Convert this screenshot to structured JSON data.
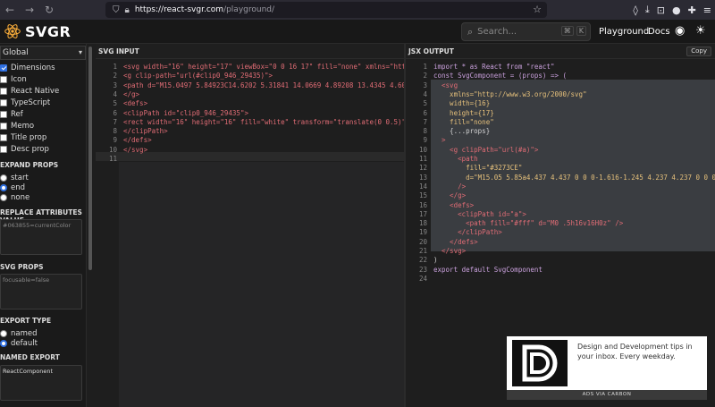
{
  "browser": {
    "url_host": "https://react-svgr.com",
    "url_path": "/playground/"
  },
  "header": {
    "logo_text": "SVGR",
    "search_placeholder": "Search...",
    "search_kbd_1": "⌘",
    "search_kbd_2": "K",
    "nav_playground": "Playground",
    "nav_docs": "Docs"
  },
  "sidebar": {
    "scope": "Global",
    "options": [
      {
        "label": "Dimensions",
        "checked": true
      },
      {
        "label": "Icon",
        "checked": false
      },
      {
        "label": "React Native",
        "checked": false
      },
      {
        "label": "TypeScript",
        "checked": false
      },
      {
        "label": "Ref",
        "checked": false
      },
      {
        "label": "Memo",
        "checked": false
      },
      {
        "label": "Title prop",
        "checked": false
      },
      {
        "label": "Desc prop",
        "checked": false
      }
    ],
    "expand_props_title": "EXPAND PROPS",
    "expand_props": [
      {
        "label": "start",
        "checked": false
      },
      {
        "label": "end",
        "checked": true
      },
      {
        "label": "none",
        "checked": false
      }
    ],
    "replace_attr_title": "REPLACE ATTRIBUTES VALUE",
    "replace_attr_placeholder": "#063855=currentColor",
    "svg_props_title": "SVG PROPS",
    "svg_props_placeholder": "focusable=false",
    "export_type_title": "EXPORT TYPE",
    "export_type": [
      {
        "label": "named",
        "checked": false
      },
      {
        "label": "default",
        "checked": true
      }
    ],
    "named_export_title": "NAMED EXPORT",
    "named_export_value": "ReactComponent"
  },
  "svg_input": {
    "title": "SVG INPUT",
    "lines": [
      "<svg width=\"16\" height=\"17\" viewBox=\"0 0 16 17\" fill=\"none\" xmlns=\"http:/",
      "<g clip-path=\"url(#clip0_946_29435)\">",
      "<path d=\"M15.0497 5.84923C14.6202 5.31841 14.0669 4.89208 13.4345 4.60462",
      "</g>",
      "<defs>",
      "<clipPath id=\"clip0_946_29435\">",
      "<rect width=\"16\" height=\"16\" fill=\"white\" transform=\"translate(0 0.5)\"/>",
      "</clipPath>",
      "</defs>",
      "</svg>",
      ""
    ]
  },
  "jsx_output": {
    "title": "JSX OUTPUT",
    "copy_label": "Copy",
    "lines": [
      "import * as React from \"react\"",
      "const SvgComponent = (props) => (",
      "  <svg",
      "    xmlns=\"http://www.w3.org/2000/svg\"",
      "    width={16}",
      "    height={17}",
      "    fill=\"none\"",
      "    {...props}",
      "  >",
      "    <g clipPath=\"url(#a)\">",
      "      <path",
      "        fill=\"#3273CE\"",
      "        d=\"M15.05 5.85a4.437 4.437 0 0 0-1.616-1.245 4.237 4.237 0 0 0-1.",
      "      />",
      "    </g>",
      "    <defs>",
      "      <clipPath id=\"a\">",
      "        <path fill=\"#fff\" d=\"M0 .5h16v16H0z\" />",
      "      </clipPath>",
      "    </defs>",
      "  </svg>",
      ")",
      "export default SvgComponent",
      ""
    ]
  },
  "ad": {
    "text": "Design and Development tips in your inbox. Every weekday.",
    "footer": "ADS VIA CARBON"
  },
  "colors": {
    "accent": "#2f6fe0",
    "react_logo": "#61dafb"
  }
}
